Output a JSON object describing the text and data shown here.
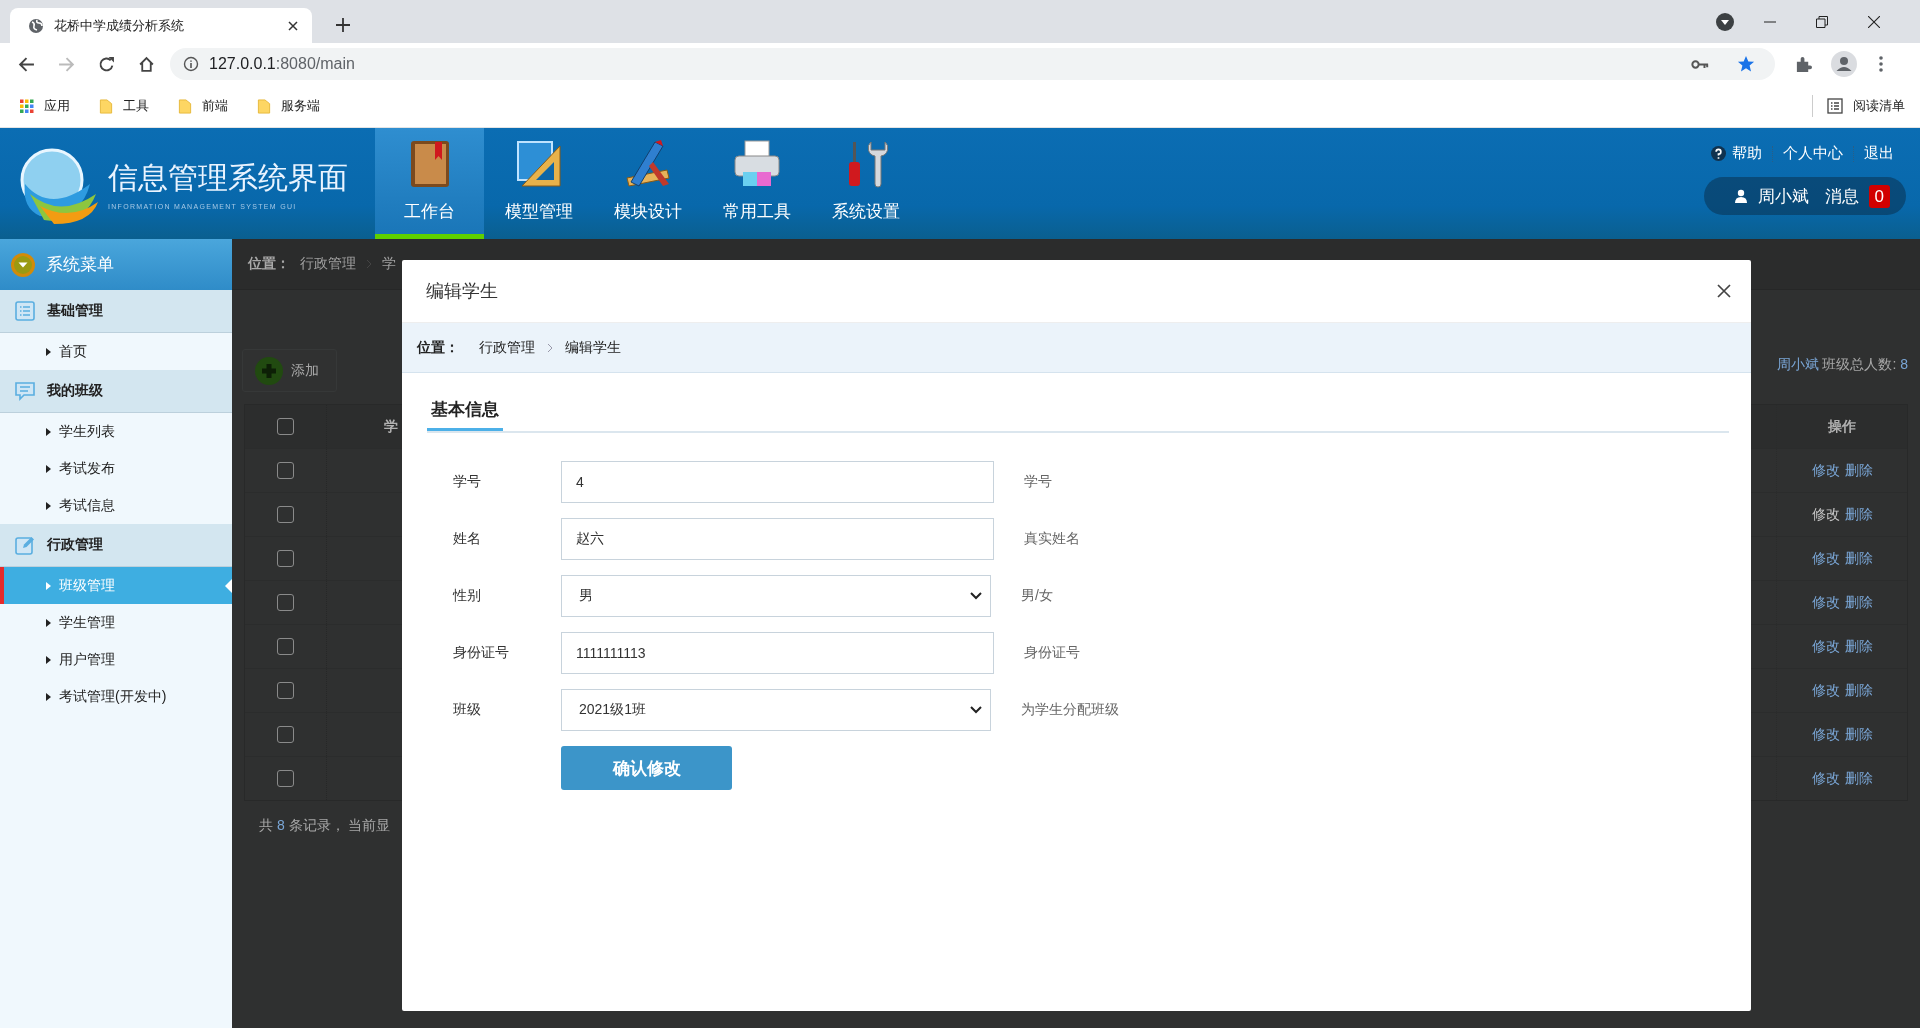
{
  "browser": {
    "tab_title": "花桥中学成绩分析系统",
    "url_host": "127.0.0.1",
    "url_rest": ":8080/main",
    "bookmarks": [
      {
        "kind": "apps",
        "label": "应用"
      },
      {
        "kind": "folder",
        "label": "工具"
      },
      {
        "kind": "folder",
        "label": "前端"
      },
      {
        "kind": "folder",
        "label": "服务端"
      }
    ],
    "reading_list": "阅读清单"
  },
  "header": {
    "title": "信息管理系统界面",
    "subtitle": "INFORMATION MANAGEMENT SYSTEM GUI",
    "nav": [
      {
        "label": "工作台",
        "selected": true
      },
      {
        "label": "模型管理",
        "selected": false
      },
      {
        "label": "模块设计",
        "selected": false
      },
      {
        "label": "常用工具",
        "selected": false
      },
      {
        "label": "系统设置",
        "selected": false
      }
    ],
    "links": [
      "帮助",
      "个人中心",
      "退出"
    ],
    "user": "周小斌",
    "messages_label": "消息",
    "message_count": "0"
  },
  "sidebar": {
    "title": "系统菜单",
    "groups": [
      {
        "label": "基础管理",
        "items": [
          {
            "label": "首页",
            "selected": false
          }
        ]
      },
      {
        "label": "我的班级",
        "items": [
          {
            "label": "学生列表",
            "selected": false
          },
          {
            "label": "考试发布",
            "selected": false
          },
          {
            "label": "考试信息",
            "selected": false
          }
        ]
      },
      {
        "label": "行政管理",
        "items": [
          {
            "label": "班级管理",
            "selected": true
          },
          {
            "label": "学生管理",
            "selected": false
          },
          {
            "label": "用户管理",
            "selected": false
          },
          {
            "label": "考试管理(开发中)",
            "selected": false
          }
        ]
      }
    ]
  },
  "page": {
    "breadcrumb": {
      "label": "位置：",
      "items": [
        "行政管理",
        "学"
      ]
    },
    "add_button": "添加",
    "summary": {
      "teacher": "周小斌",
      "label": "班级总人数:",
      "count": "8"
    },
    "table": {
      "all_checked": false,
      "column_2": "学",
      "action_header": "操作",
      "rows": [
        {
          "checked": false,
          "edit": "修改",
          "delete": "删除",
          "hovered": false
        },
        {
          "checked": false,
          "edit": "修改",
          "delete": "删除",
          "hovered": true
        },
        {
          "checked": false,
          "edit": "修改",
          "delete": "删除",
          "hovered": false
        },
        {
          "checked": false,
          "edit": "修改",
          "delete": "删除",
          "hovered": false
        },
        {
          "checked": false,
          "edit": "修改",
          "delete": "删除",
          "hovered": false
        },
        {
          "checked": false,
          "edit": "修改",
          "delete": "删除",
          "hovered": false
        },
        {
          "checked": false,
          "edit": "修改",
          "delete": "删除",
          "hovered": false
        },
        {
          "checked": false,
          "edit": "修改",
          "delete": "删除",
          "hovered": false
        }
      ]
    },
    "footer": {
      "prefix": "共",
      "count": "8",
      "suffix": "条记录， 当前显"
    }
  },
  "modal": {
    "title": "编辑学生",
    "breadcrumb": {
      "label": "位置：",
      "items": [
        "行政管理",
        "编辑学生"
      ]
    },
    "tab": "基本信息",
    "fields": [
      {
        "label": "学号",
        "kind": "text",
        "value": "4",
        "hint": "学号"
      },
      {
        "label": "姓名",
        "kind": "text",
        "value": "赵六",
        "hint": "真实姓名"
      },
      {
        "label": "性别",
        "kind": "select",
        "value": "男",
        "hint": "男/女"
      },
      {
        "label": "身份证号",
        "kind": "text",
        "value": "1111111113",
        "hint": "身份证号"
      },
      {
        "label": "班级",
        "kind": "select",
        "value": "2021级1班",
        "hint": "为学生分配班级"
      }
    ],
    "submit": "确认修改"
  }
}
